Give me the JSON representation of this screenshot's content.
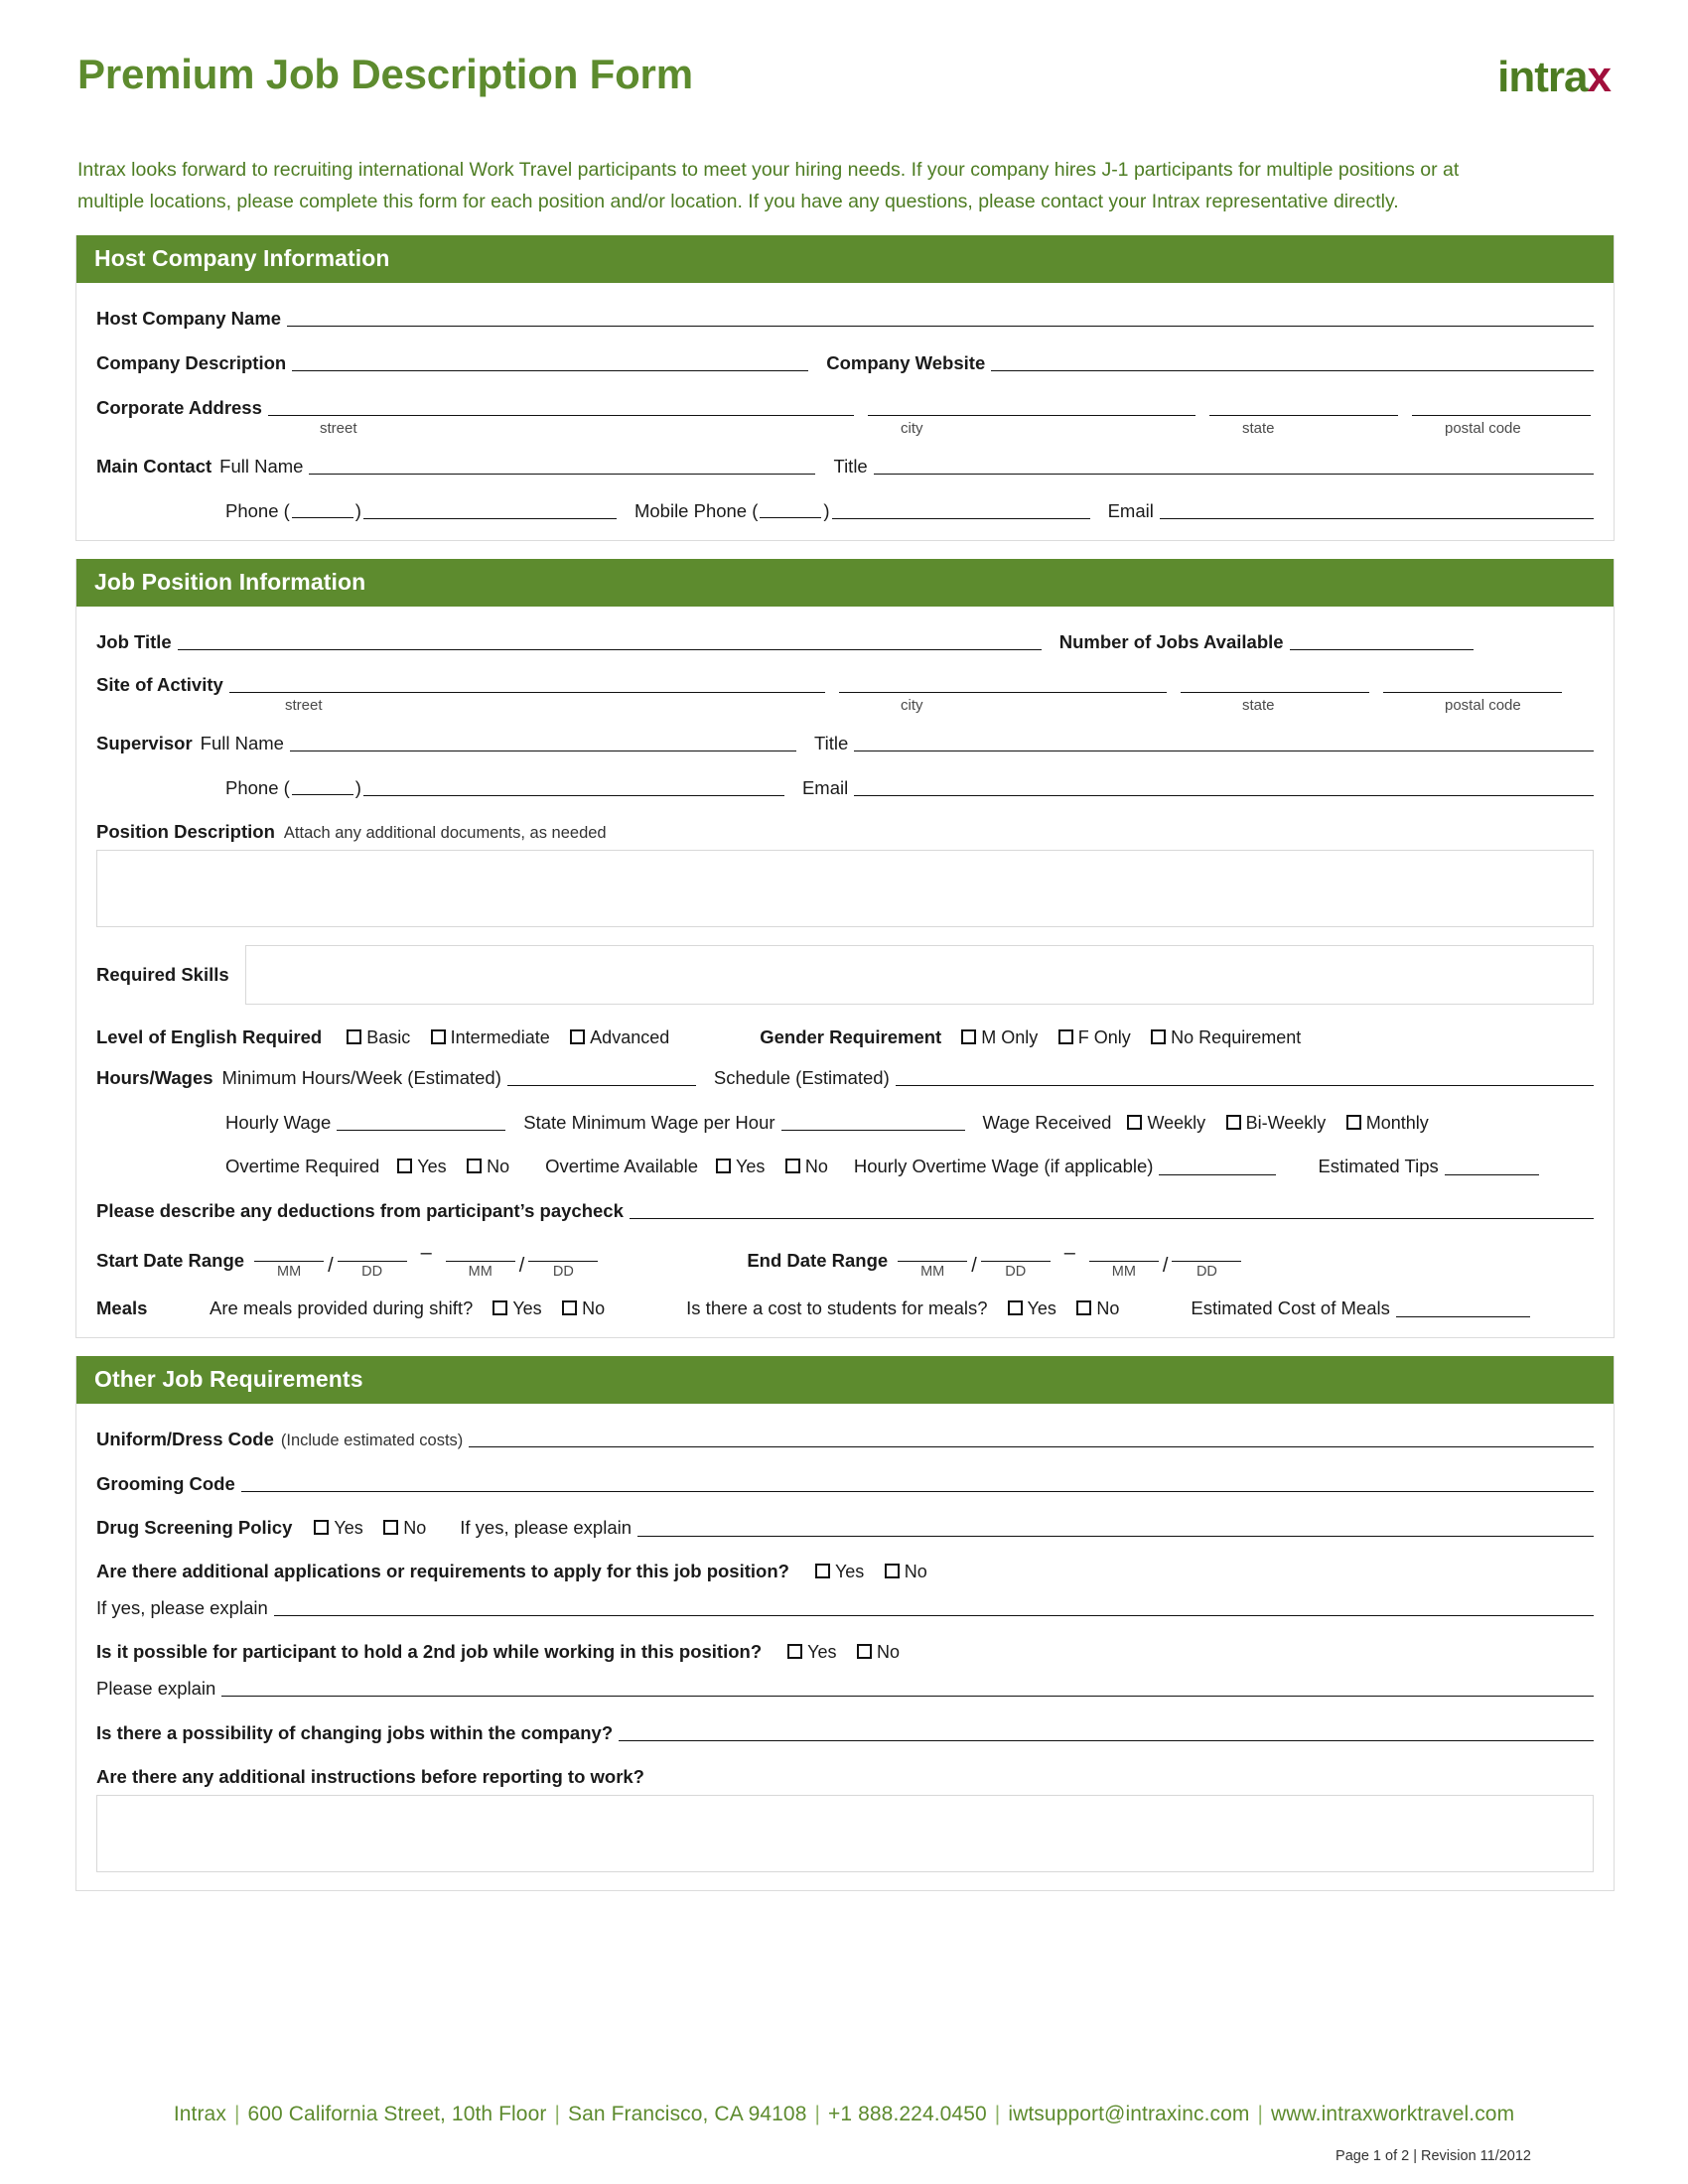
{
  "header": {
    "title": "Premium Job Description Form",
    "logo_main": "intra",
    "logo_accent": "x"
  },
  "intro": {
    "text": "Intrax looks forward to recruiting international Work Travel participants to meet your hiring needs. If your company hires J-1 participants for multiple positions or at multiple locations, please complete this form for each position and/or location. If you have any questions, please contact your Intrax representative directly."
  },
  "colors": {
    "brand_green": "#5d8b2e",
    "logo_green": "#4d7c22",
    "logo_accent": "#a10f3c",
    "rule": "#111111",
    "box_border": "#d8d8d8"
  },
  "host_company": {
    "section_title": "Host Company Information",
    "company_name_label": "Host Company Name",
    "company_description_label": "Company Description",
    "company_website_label": "Company Website",
    "corporate_address_label": "Corporate Address",
    "address_captions": {
      "street": "street",
      "city": "city",
      "state": "state",
      "postal": "postal code"
    },
    "main_contact_label": "Main Contact",
    "full_name_label": "Full Name",
    "title_label": "Title",
    "phone_label": "Phone (",
    "phone_label_close": ")",
    "mobile_phone_label": "Mobile Phone (",
    "mobile_phone_close": ")",
    "email_label": "Email"
  },
  "job_position": {
    "section_title": "Job Position Information",
    "job_title_label": "Job Title",
    "number_of_jobs_label": "Number of Jobs Available",
    "site_of_activity_label": "Site of Activity",
    "address_captions": {
      "street": "street",
      "city": "city",
      "state": "state",
      "postal": "postal code"
    },
    "supervisor_label": "Supervisor",
    "full_name_label": "Full Name",
    "title_label": "Title",
    "phone_label": "Phone (",
    "phone_label_close": ")",
    "email_label": "Email",
    "position_description_label": "Position Description",
    "position_description_hint": "Attach any additional documents, as needed",
    "required_skills_label": "Required Skills",
    "english_label": "Level of English Required",
    "english_options": [
      "Basic",
      "Intermediate",
      "Advanced"
    ],
    "gender_label": "Gender Requirement",
    "gender_options": [
      "M Only",
      "F Only",
      "No Requirement"
    ],
    "hours_wages_label": "Hours/Wages",
    "min_hours_label": "Minimum Hours/Week (Estimated)",
    "schedule_label": "Schedule (Estimated)",
    "hourly_wage_label": "Hourly Wage",
    "state_min_wage_label": "State Minimum Wage per Hour",
    "wage_received_label": "Wage Received",
    "wage_received_options": [
      "Weekly",
      "Bi-Weekly",
      "Monthly"
    ],
    "overtime_required_label": "Overtime Required",
    "overtime_required_options": [
      "Yes",
      "No"
    ],
    "overtime_available_label": "Overtime Available",
    "overtime_available_options": [
      "Yes",
      "No"
    ],
    "hourly_overtime_wage_label": "Hourly Overtime Wage (if applicable)",
    "estimated_tips_label": "Estimated Tips",
    "deductions_label": "Please describe any deductions from participant’s paycheck",
    "start_date_label": "Start Date Range",
    "end_date_label": "End Date Range",
    "date_captions": {
      "mm": "MM",
      "dd": "DD"
    },
    "date_separator": "–",
    "date_slash": "/",
    "meals_label": "Meals",
    "meals_provided_q": "Are meals provided during shift?",
    "meals_provided_options": [
      "Yes",
      "No"
    ],
    "meals_cost_q": "Is there a cost to students for meals?",
    "meals_cost_options": [
      "Yes",
      "No"
    ],
    "estimated_cost_meals_label": "Estimated Cost of Meals"
  },
  "other_requirements": {
    "section_title": "Other Job Requirements",
    "uniform_label": "Uniform/Dress Code",
    "uniform_hint": "(Include estimated costs)",
    "grooming_label": "Grooming Code",
    "drug_label": "Drug Screening Policy",
    "drug_options": [
      "Yes",
      "No"
    ],
    "drug_explain_label": "If yes, please explain",
    "additional_apps_q": "Are there additional applications or requirements to apply for this job position?",
    "additional_apps_options": [
      "Yes",
      "No"
    ],
    "if_yes_explain_label": "If yes, please explain",
    "second_job_q": "Is it possible for participant to hold a 2nd job while working in this position?",
    "second_job_options": [
      "Yes",
      "No"
    ],
    "please_explain_label": "Please explain",
    "changing_jobs_q": "Is there a possibility of changing jobs within the company?",
    "additional_instructions_q": "Are there any additional instructions before reporting to work?"
  },
  "footer": {
    "org": "Intrax",
    "address": "600 California Street, 10th Floor",
    "city": "San Francisco, CA 94108",
    "phone": "+1 888.224.0450",
    "email": "iwtsupport@intraxinc.com",
    "website": "www.intraxworktravel.com",
    "separator": "|",
    "revision": "Page 1 of 2 | Revision 11/2012"
  }
}
